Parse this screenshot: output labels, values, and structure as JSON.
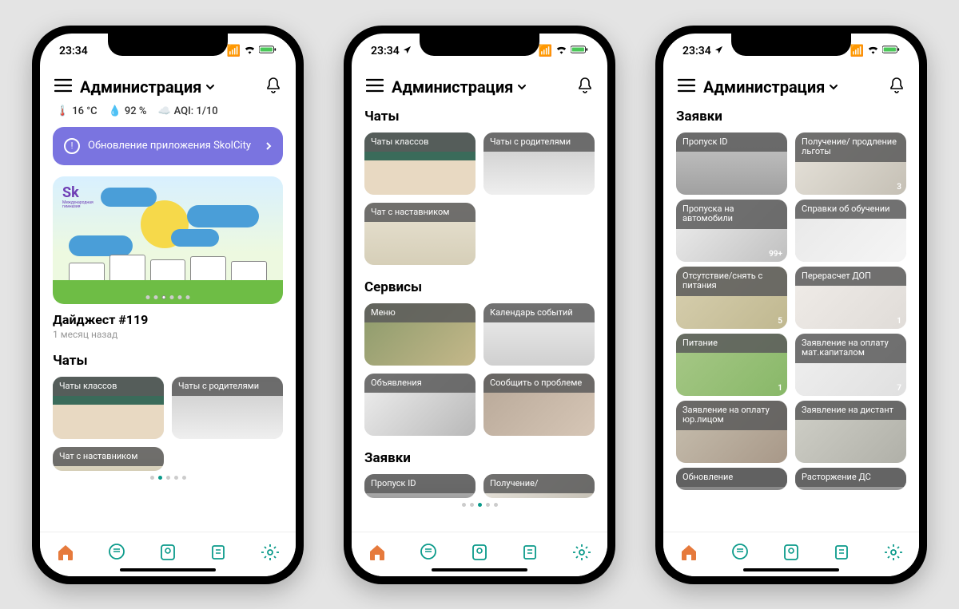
{
  "status_time": "23:34",
  "app_header": "Администрация",
  "screen1": {
    "weather": {
      "temp": "16 °C",
      "humidity": "92 %",
      "aqi": "AQI: 1/10"
    },
    "banner_text": "Обновление приложения SkolCity",
    "digest_logo": "Sk",
    "digest_logo_sub": "Международная\nгимназия",
    "digest_title": "Дайджест #119",
    "digest_time": "1 месяц назад",
    "section_chats": "Чаты",
    "tiles": {
      "t1": "Чаты классов",
      "t2": "Чаты с родителями",
      "t3": "Чат с наставником"
    }
  },
  "screen2": {
    "section_chats": "Чаты",
    "tiles_chats": {
      "t1": "Чаты классов",
      "t2": "Чаты с родителями",
      "t3": "Чат с наставником"
    },
    "section_services": "Сервисы",
    "tiles_services": {
      "t1": "Меню",
      "t2": "Календарь событий",
      "t3": "Объявления",
      "t4": "Сообщить о проблеме"
    },
    "section_requests": "Заявки",
    "tiles_requests": {
      "t1": "Пропуск ID",
      "t2": "Получение/"
    }
  },
  "screen3": {
    "section_requests": "Заявки",
    "tiles": {
      "t1": {
        "label": "Пропуск ID",
        "badge": ""
      },
      "t2": {
        "label": "Получение/ продление льготы",
        "badge": "3"
      },
      "t3": {
        "label": "Пропуска на автомобили",
        "badge": "99+"
      },
      "t4": {
        "label": "Справки об обучении",
        "badge": ""
      },
      "t5": {
        "label": "Отсутствие/снять с питания",
        "badge": "5"
      },
      "t6": {
        "label": "Перерасчет ДОП",
        "badge": "1"
      },
      "t7": {
        "label": "Питание",
        "badge": "1"
      },
      "t8": {
        "label": "Заявление на оплату мат.капиталом",
        "badge": "7"
      },
      "t9": {
        "label": "Заявление на оплату юр.лицом",
        "badge": ""
      },
      "t10": {
        "label": "Заявление на дистант",
        "badge": ""
      },
      "t11": {
        "label": "Обновление",
        "badge": ""
      },
      "t12": {
        "label": "Расторжение ДС",
        "badge": ""
      }
    }
  }
}
